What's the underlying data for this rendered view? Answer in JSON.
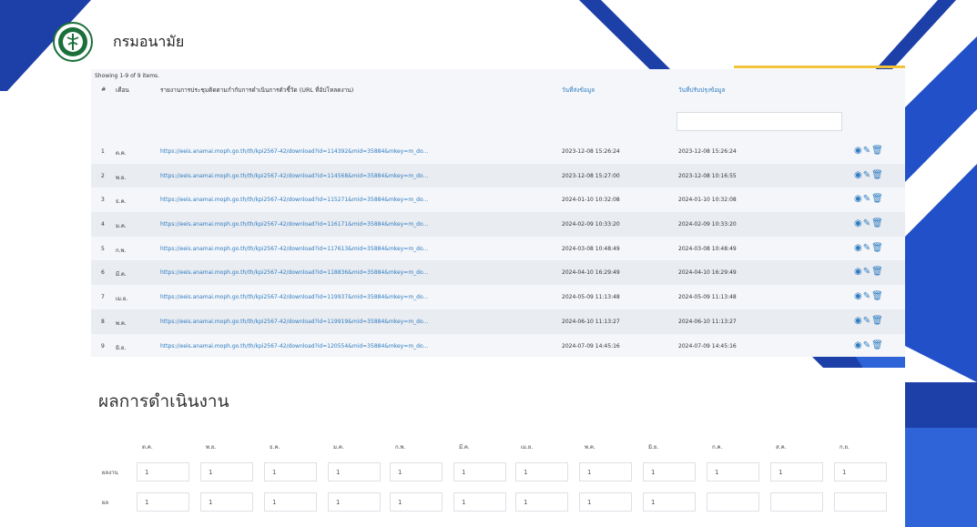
{
  "site": {
    "title": "กรมอนามัย"
  },
  "table": {
    "summary": "Showing 1-9 of 9 items.",
    "headers": {
      "num": "#",
      "month": "เดือน",
      "file": "รายงานการประชุมติดตามกำกับการดำเนินการตัวชี้วัด (URL ที่อัปโหลดงาน)",
      "sent_date": "วันที่ส่งข้อมูล",
      "updated_date": "วันที่ปรับปรุงข้อมูล"
    },
    "rows": [
      {
        "num": "1",
        "month": "ต.ค.",
        "url": "https://eeis.anamai.moph.go.th/th/kpi2567-42/download?id=114392&mid=35884&mkey=m_do...",
        "sent": "2023-12-08 15:26:24",
        "updated": "2023-12-08 15:26:24"
      },
      {
        "num": "2",
        "month": "พ.ย.",
        "url": "https://eeis.anamai.moph.go.th/th/kpi2567-42/download?id=114568&mid=35884&mkey=m_do...",
        "sent": "2023-12-08 15:27:00",
        "updated": "2023-12-08 10:16:55"
      },
      {
        "num": "3",
        "month": "ธ.ค.",
        "url": "https://eeis.anamai.moph.go.th/th/kpi2567-42/download?id=115271&mid=35884&mkey=m_do...",
        "sent": "2024-01-10 10:32:08",
        "updated": "2024-01-10 10:32:08"
      },
      {
        "num": "4",
        "month": "ม.ค.",
        "url": "https://eeis.anamai.moph.go.th/th/kpi2567-42/download?id=116171&mid=35884&mkey=m_do...",
        "sent": "2024-02-09 10:33:20",
        "updated": "2024-02-09 10:33:20"
      },
      {
        "num": "5",
        "month": "ก.พ.",
        "url": "https://eeis.anamai.moph.go.th/th/kpi2567-42/download?id=117613&mid=35884&mkey=m_do...",
        "sent": "2024-03-08 10:48:49",
        "updated": "2024-03-08 10:48:49"
      },
      {
        "num": "6",
        "month": "มี.ค.",
        "url": "https://eeis.anamai.moph.go.th/th/kpi2567-42/download?id=118836&mid=35884&mkey=m_do...",
        "sent": "2024-04-10 16:29:49",
        "updated": "2024-04-10 16:29:49"
      },
      {
        "num": "7",
        "month": "เม.ย.",
        "url": "https://eeis.anamai.moph.go.th/th/kpi2567-42/download?id=119937&mid=35884&mkey=m_do...",
        "sent": "2024-05-09 11:13:48",
        "updated": "2024-05-09 11:13:48"
      },
      {
        "num": "8",
        "month": "พ.ค.",
        "url": "https://eeis.anamai.moph.go.th/th/kpi2567-42/download?id=119919&mid=35884&mkey=m_do...",
        "sent": "2024-06-10 11:13:27",
        "updated": "2024-06-10 11:13:27"
      },
      {
        "num": "9",
        "month": "มิ.ย.",
        "url": "https://eeis.anamai.moph.go.th/th/kpi2567-42/download?id=120554&mid=35884&mkey=m_do...",
        "sent": "2024-07-09 14:45:16",
        "updated": "2024-07-09 14:45:16"
      }
    ],
    "action_icons": {
      "view": "eye-icon",
      "edit": "pencil-icon",
      "delete": "trash-icon"
    },
    "action_glyphs": {
      "view": "◉",
      "edit": "✎",
      "delete": "🗑"
    }
  },
  "results": {
    "title": "ผลการดำเนินงาน",
    "months": [
      "ต.ค.",
      "พ.ย.",
      "ธ.ค.",
      "ม.ค.",
      "ก.พ.",
      "มี.ค.",
      "เม.ย.",
      "พ.ค.",
      "มิ.ย.",
      "ก.ค.",
      "ส.ค.",
      "ก.ย."
    ],
    "row_labels": [
      "ผลงาน",
      "ผล"
    ],
    "values": [
      [
        "1",
        "1",
        "1",
        "1",
        "1",
        "1",
        "1",
        "1",
        "1",
        "1",
        "1",
        "1"
      ],
      [
        "1",
        "1",
        "1",
        "1",
        "1",
        "1",
        "1",
        "1",
        "1",
        "",
        "",
        ""
      ]
    ]
  },
  "colors": {
    "accent": "#2f7cc1",
    "brand_blue": "#1d3fa8",
    "gold": "#f2c23a",
    "logo_green": "#1b6f3a"
  }
}
